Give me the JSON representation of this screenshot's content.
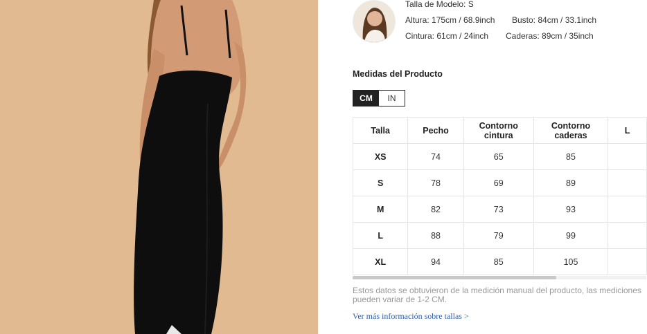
{
  "model": {
    "size_line": "Talla de Modelo: S",
    "height": "Altura: 175cm / 68.9inch",
    "bust": "Busto: 84cm / 33.1inch",
    "waist": "Cintura: 61cm / 24inch",
    "hips": "Caderas: 89cm / 35inch"
  },
  "measurements": {
    "title": "Medidas del Producto",
    "units": [
      "CM",
      "IN"
    ],
    "active_unit": "CM",
    "headers": [
      "Talla",
      "Pecho",
      "Contorno cintura",
      "Contorno caderas",
      "L"
    ],
    "rows": [
      [
        "XS",
        "74",
        "65",
        "85",
        ""
      ],
      [
        "S",
        "78",
        "69",
        "89",
        ""
      ],
      [
        "M",
        "82",
        "73",
        "93",
        ""
      ],
      [
        "L",
        "88",
        "79",
        "99",
        ""
      ],
      [
        "XL",
        "94",
        "85",
        "105",
        ""
      ]
    ],
    "note": "Estos datos se obtuvieron de la medición manual del producto, las mediciones pueden variar de 1-2 CM.",
    "more_link": "Ver más información sobre tallas >"
  },
  "colors": {
    "photo_background": "#e1ba91",
    "dress": "#0e0e0e",
    "skin": "#d29b76",
    "hair": "#8a5a33",
    "link": "#2a5db0",
    "active_unit_bg": "#222222"
  },
  "icons": {
    "product_photo": "product-photo",
    "model_avatar": "model-avatar"
  }
}
